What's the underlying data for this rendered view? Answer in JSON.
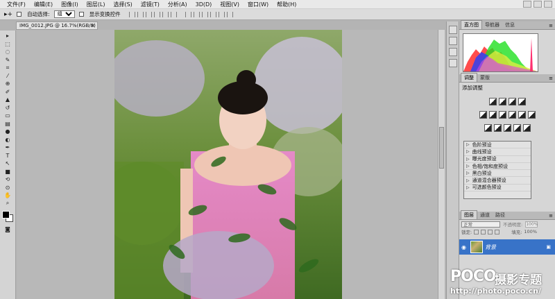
{
  "menubar": {
    "items": [
      "文件(F)",
      "编辑(E)",
      "图像(I)",
      "图层(L)",
      "选择(S)",
      "滤镜(T)",
      "分析(A)",
      "3D(D)",
      "视图(V)",
      "窗口(W)",
      "帮助(H)"
    ]
  },
  "options_bar": {
    "auto_select_label": "自动选择:",
    "auto_select_value": "组",
    "show_transform_label": "显示变换控件"
  },
  "document": {
    "tab_title": "IMG_0012.JPG @ 16.7%(RGB/8)",
    "close_glyph": "×"
  },
  "histogram_panel": {
    "tabs": [
      "直方图",
      "导航器",
      "信息"
    ]
  },
  "adjustments_panel": {
    "tabs": [
      "调整",
      "蒙版"
    ],
    "title": "添加调整",
    "presets": [
      "色阶预设",
      "曲线预设",
      "曝光度预设",
      "色相/饱和度预设",
      "黑白预设",
      "通道混合器预设",
      "可选颜色预设"
    ]
  },
  "layers_panel": {
    "tabs": [
      "图层",
      "通道",
      "路径"
    ],
    "blend_mode": "正常",
    "opacity_label": "不透明度:",
    "opacity_value": "100%",
    "lock_label": "锁定:",
    "fill_label": "填充:",
    "fill_value": "100%",
    "layer_name": "背景"
  },
  "watermark": {
    "logo": "POCO",
    "cn_text": "摄影专题",
    "url": "http://photo.poco.cn/"
  },
  "icons": [
    "move-tool-icon",
    "marquee-tool-icon",
    "lasso-tool-icon",
    "quick-select-icon",
    "crop-tool-icon",
    "eyedropper-icon",
    "healing-brush-icon",
    "brush-tool-icon",
    "clone-stamp-icon",
    "history-brush-icon",
    "eraser-icon",
    "gradient-icon",
    "blur-icon",
    "dodge-icon",
    "pen-tool-icon",
    "type-tool-icon",
    "path-select-icon",
    "shape-tool-icon",
    "3d-rotate-icon",
    "3d-orbit-icon",
    "hand-tool-icon",
    "zoom-tool-icon",
    "quick-mask-icon",
    "eye-icon",
    "lock-icon"
  ]
}
